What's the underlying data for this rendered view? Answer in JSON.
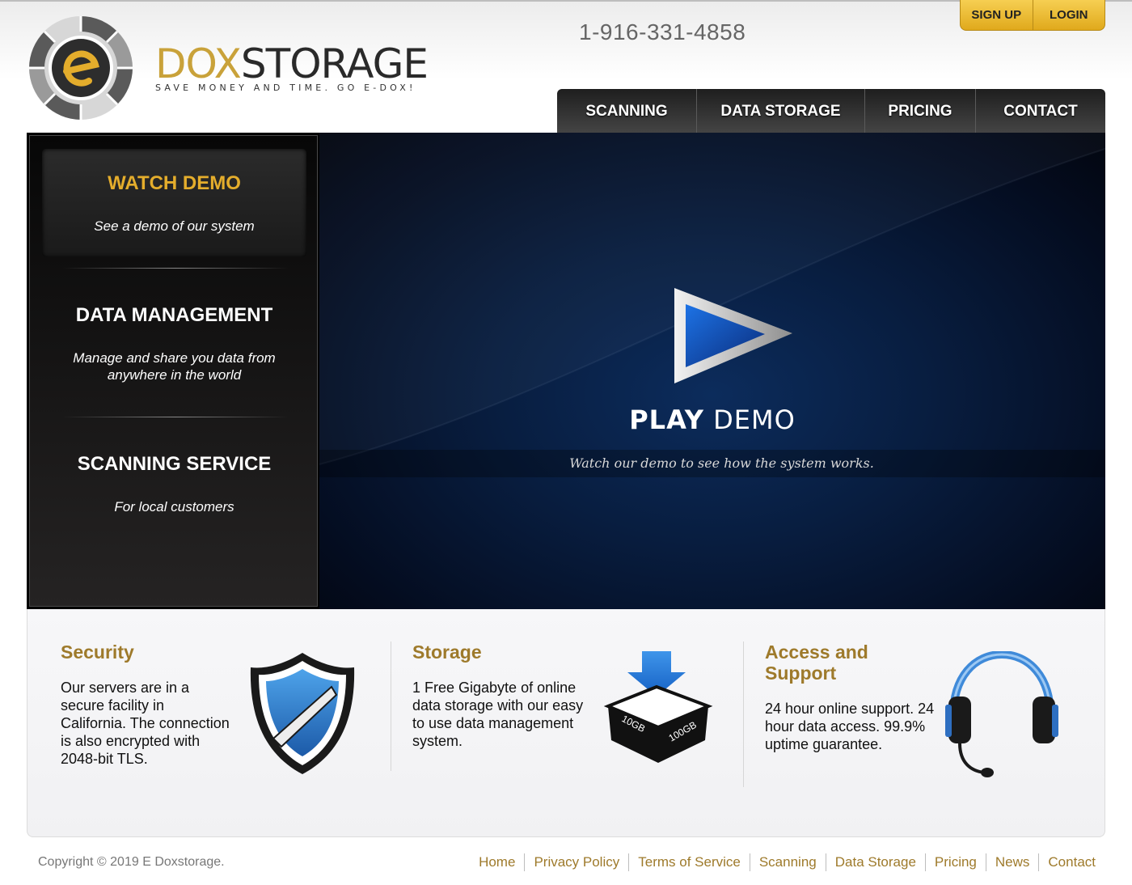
{
  "header": {
    "brand_part1": "DOX",
    "brand_part2": "STORAGE",
    "tagline": "SAVE MONEY AND TIME. GO E-DOX!",
    "phone": "1-916-331-4858",
    "auth": {
      "signup": "SIGN UP",
      "login": "LOGIN"
    },
    "nav": [
      "SCANNING",
      "DATA STORAGE",
      "PRICING",
      "CONTACT"
    ]
  },
  "sidebar": [
    {
      "title": "WATCH DEMO",
      "subtitle": "See a demo of our system",
      "active": true
    },
    {
      "title": "DATA MANAGEMENT",
      "subtitle": "Manage and share you data from anywhere in the world",
      "active": false
    },
    {
      "title": "SCANNING SERVICE",
      "subtitle": "For local customers",
      "active": false
    }
  ],
  "demo": {
    "play_bold": "PLAY",
    "play_light": "DEMO",
    "caption": "Watch our demo to see how the system works."
  },
  "features": [
    {
      "title": "Security",
      "body": "Our servers are in a secure facility in California. The connection is also encrypted with 2048-bit TLS.",
      "icon": "shield-icon"
    },
    {
      "title": "Storage",
      "body": "1 Free Gigabyte of online data storage with our easy to use data management system.",
      "icon": "storage-box-icon",
      "box_labels": [
        "10GB",
        "100GB"
      ]
    },
    {
      "title": "Access and Support",
      "body": "24 hour online support. 24 hour data access. 99.9% uptime guarantee.",
      "icon": "headset-icon"
    }
  ],
  "footer": {
    "copyright": "Copyright © 2019 E Doxstorage.",
    "links": [
      "Home",
      "Privacy Policy",
      "Terms of Service",
      "Scanning",
      "Data Storage",
      "Pricing",
      "News",
      "Contact"
    ]
  },
  "colors": {
    "gold_accent": "#e4ad2c",
    "feature_title": "#9e7a2b",
    "nav_dark": "#2b2b2b",
    "stage_blue": "#0c2c5c"
  }
}
